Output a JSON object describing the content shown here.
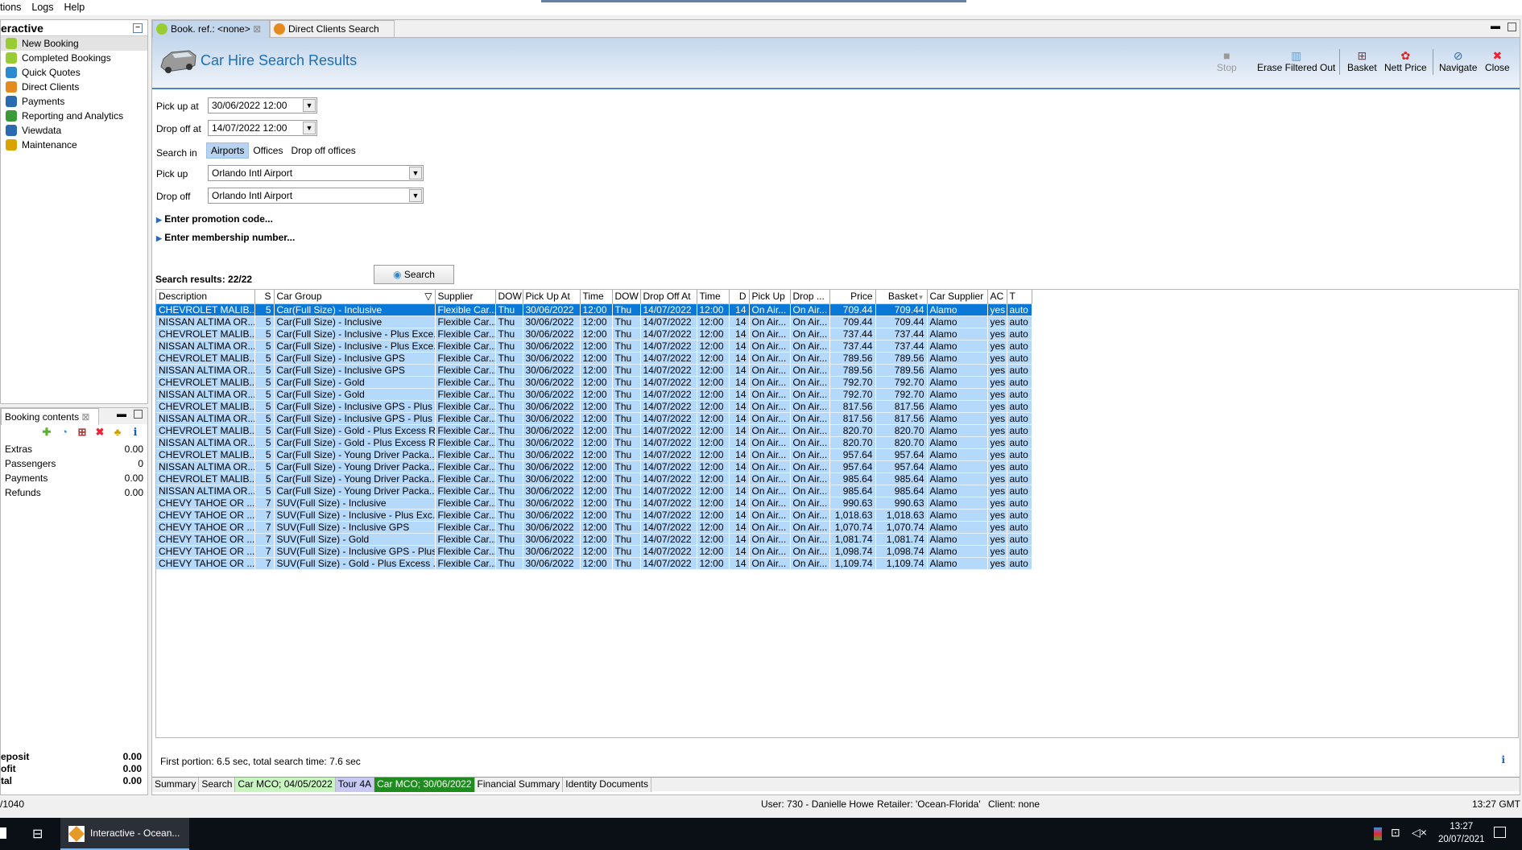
{
  "menu": [
    "tions",
    "Logs",
    "Help"
  ],
  "nav": {
    "title": "eractive",
    "items": [
      "New Booking",
      "Completed Bookings",
      "Quick Quotes",
      "Direct Clients",
      "Payments",
      "Reporting and Analytics",
      "Viewdata",
      "Maintenance"
    ]
  },
  "booking": {
    "tab": "Booking contents",
    "rows": [
      {
        "label": "Extras",
        "value": "0.00"
      },
      {
        "label": "Passengers",
        "value": "0"
      },
      {
        "label": "Payments",
        "value": "0.00"
      },
      {
        "label": "Refunds",
        "value": "0.00"
      }
    ],
    "totals": [
      {
        "label": "eposit",
        "value": "0.00"
      },
      {
        "label": "ofit",
        "value": "0.00"
      },
      {
        "label": "tal",
        "value": "0.00"
      }
    ]
  },
  "tabs": [
    "Book. ref.: <none>",
    "Direct Clients Search"
  ],
  "header": {
    "title": "Car Hire Search Results"
  },
  "toolbar": {
    "stop": "Stop",
    "erase": "Erase Filtered Out",
    "basket": "Basket",
    "nett": "Nett Price",
    "navigate": "Navigate",
    "close": "Close"
  },
  "form": {
    "pickup_at_label": "Pick up at",
    "pickup_at": "30/06/2022 12:00",
    "dropoff_at_label": "Drop off at",
    "dropoff_at": "14/07/2022 12:00",
    "search_in_label": "Search in",
    "search_in": [
      "Airports",
      "Offices",
      "Drop off offices"
    ],
    "pickup_label": "Pick up",
    "pickup": "Orlando Intl Airport",
    "dropoff_label": "Drop off",
    "dropoff": "Orlando Intl Airport",
    "promo": "Enter promotion code...",
    "membership": "Enter membership number...",
    "search": "Search"
  },
  "results": {
    "label": "Search results: 22/22",
    "columns": [
      "Description",
      "S",
      "Car Group",
      "Supplier",
      "DOW",
      "Pick Up At",
      "Time",
      "DOW",
      "Drop Off At",
      "Time",
      "D",
      "Pick Up",
      "Drop ...",
      "Price",
      "Basket",
      "Car Supplier",
      "AC",
      "T"
    ],
    "rows": [
      [
        "CHEVROLET MALIB...",
        "5",
        "Car(Full Size) - Inclusive",
        "709.44"
      ],
      [
        "NISSAN ALTIMA OR...",
        "5",
        "Car(Full Size) - Inclusive",
        "709.44"
      ],
      [
        "CHEVROLET MALIB...",
        "5",
        "Car(Full Size) - Inclusive - Plus Exce...",
        "737.44"
      ],
      [
        "NISSAN ALTIMA OR...",
        "5",
        "Car(Full Size) - Inclusive - Plus Exce...",
        "737.44"
      ],
      [
        "CHEVROLET MALIB...",
        "5",
        "Car(Full Size) - Inclusive GPS",
        "789.56"
      ],
      [
        "NISSAN ALTIMA OR...",
        "5",
        "Car(Full Size) - Inclusive GPS",
        "789.56"
      ],
      [
        "CHEVROLET MALIB...",
        "5",
        "Car(Full Size) - Gold",
        "792.70"
      ],
      [
        "NISSAN ALTIMA OR...",
        "5",
        "Car(Full Size) - Gold",
        "792.70"
      ],
      [
        "CHEVROLET MALIB...",
        "5",
        "Car(Full Size) - Inclusive GPS - Plus ...",
        "817.56"
      ],
      [
        "NISSAN ALTIMA OR...",
        "5",
        "Car(Full Size) - Inclusive GPS - Plus ...",
        "817.56"
      ],
      [
        "CHEVROLET MALIB...",
        "5",
        "Car(Full Size) - Gold - Plus Excess R...",
        "820.70"
      ],
      [
        "NISSAN ALTIMA OR...",
        "5",
        "Car(Full Size) - Gold - Plus Excess R...",
        "820.70"
      ],
      [
        "CHEVROLET MALIB...",
        "5",
        "Car(Full Size) - Young Driver Packa...",
        "957.64"
      ],
      [
        "NISSAN ALTIMA OR...",
        "5",
        "Car(Full Size) - Young Driver Packa...",
        "957.64"
      ],
      [
        "CHEVROLET MALIB...",
        "5",
        "Car(Full Size) - Young Driver Packa...",
        "985.64"
      ],
      [
        "NISSAN ALTIMA OR...",
        "5",
        "Car(Full Size) - Young Driver Packa...",
        "985.64"
      ],
      [
        "CHEVY TAHOE OR ...",
        "7",
        "SUV(Full Size) - Inclusive",
        "990.63"
      ],
      [
        "CHEVY TAHOE OR ...",
        "7",
        "SUV(Full Size) - Inclusive - Plus Exc...",
        "1,018.63"
      ],
      [
        "CHEVY TAHOE OR ...",
        "7",
        "SUV(Full Size) - Inclusive GPS",
        "1,070.74"
      ],
      [
        "CHEVY TAHOE OR ...",
        "7",
        "SUV(Full Size) - Gold",
        "1,081.74"
      ],
      [
        "CHEVY TAHOE OR ...",
        "7",
        "SUV(Full Size) - Inclusive GPS - Plus...",
        "1,098.74"
      ],
      [
        "CHEVY TAHOE OR ...",
        "7",
        "SUV(Full Size) - Gold - Plus Excess ...",
        "1,109.74"
      ]
    ],
    "common": {
      "supplier": "Flexible Car...",
      "dow1": "Thu",
      "pickup_date": "30/06/2022",
      "time1": "12:00",
      "dow2": "Thu",
      "dropoff_date": "14/07/2022",
      "time2": "12:00",
      "days": "14",
      "pickup": "On Air...",
      "dropoff": "On Air...",
      "car_supplier": "Alamo",
      "ac": "yes",
      "trans": "auto"
    }
  },
  "status_msg": "First portion: 6.5 sec, total search time: 7.6 sec",
  "bottom_tabs": [
    "Summary",
    "Search",
    "Car MCO; 04/05/2022",
    "Tour 4A",
    "Car MCO; 30/06/2022",
    "Financial Summary",
    "Identity Documents"
  ],
  "bottom_tab_colors": [
    "#f0f0f0",
    "#f0f0f0",
    "#c8f5c0",
    "#c8c8f5",
    "#1e8c1e",
    "#f0f0f0",
    "#f0f0f0"
  ],
  "statusbar": {
    "left": "/1040",
    "user": "User: 730 - Danielle Howe",
    "retailer": "Retailer: 'Ocean-Florida'",
    "client": "Client: none",
    "time": "13:27 GMT"
  },
  "taskbar": {
    "app": "Interactive - Ocean...",
    "time": "13:27",
    "date": "20/07/2021"
  }
}
